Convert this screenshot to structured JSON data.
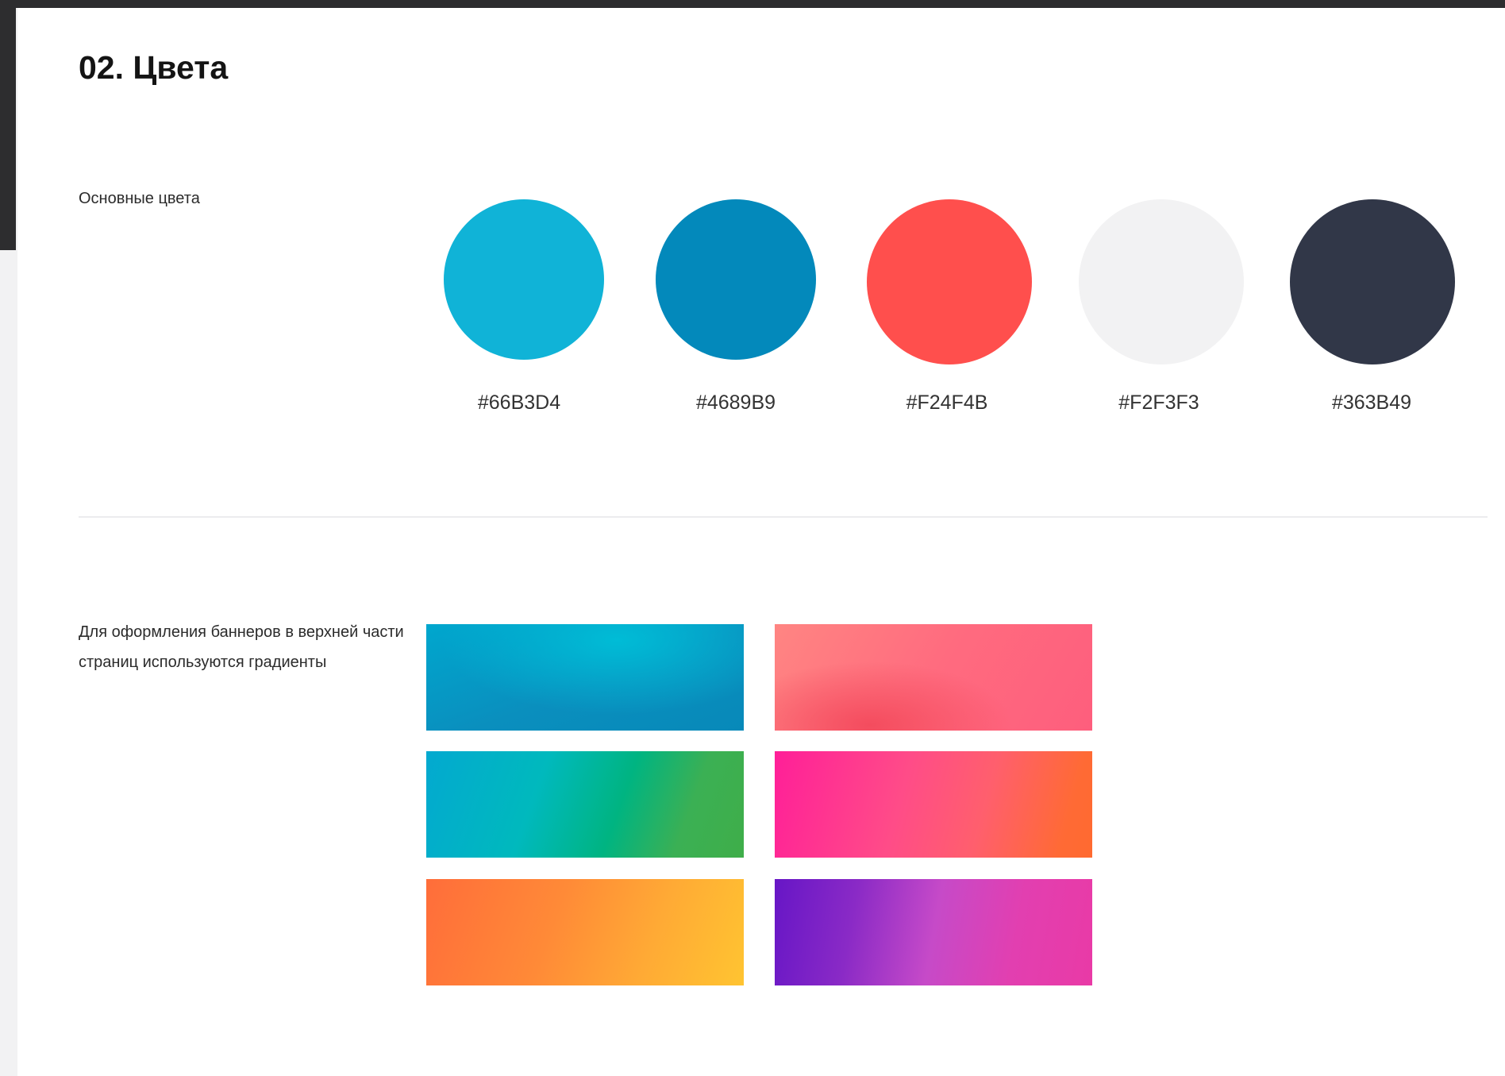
{
  "page": {
    "title": "02. Цвета"
  },
  "main_colors": {
    "caption": "Основные цвета",
    "swatches": [
      {
        "label": "#66B3D4",
        "color": "#10B3D7"
      },
      {
        "label": "#4689B9",
        "color": "#0389BB"
      },
      {
        "label": "#F24F4B",
        "color": "#FF4F4D"
      },
      {
        "label": "#F2F3F3",
        "color": "#F2F2F3"
      },
      {
        "label": "#363B49",
        "color": "#313748"
      }
    ]
  },
  "gradients": {
    "caption": "Для оформления баннеров в верхней части страниц используются градиенты",
    "items": [
      {
        "name": "blue",
        "colors": [
          "#00A7CE",
          "#00BCD6",
          "#0789B9"
        ]
      },
      {
        "name": "coral-pink",
        "colors": [
          "#FF8582",
          "#F44C5E",
          "#FE5E7D"
        ]
      },
      {
        "name": "blue-green",
        "colors": [
          "#03A9D0",
          "#00B481",
          "#3FAE49"
        ]
      },
      {
        "name": "pink-orange",
        "colors": [
          "#FF1F98",
          "#FF5F6D",
          "#FF6A30"
        ]
      },
      {
        "name": "orange-yellow",
        "colors": [
          "#FF6D3A",
          "#FFAA35",
          "#FFC431"
        ]
      },
      {
        "name": "purple-magenta",
        "colors": [
          "#6716C6",
          "#C64AC8",
          "#E93AA6"
        ]
      }
    ]
  }
}
